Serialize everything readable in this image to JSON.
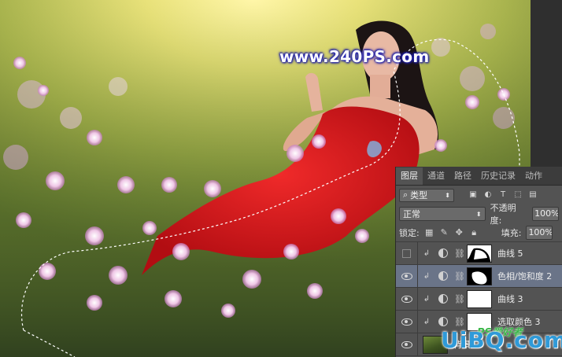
{
  "watermark": "www.240PS.com",
  "panel": {
    "tabs": [
      "图层",
      "通道",
      "路径",
      "历史记录",
      "动作"
    ],
    "active_tab": "图层",
    "filter_label": "类型",
    "blend_mode": "正常",
    "opacity_label": "不透明度:",
    "opacity_value": "100%",
    "lock_label": "锁定:",
    "fill_label": "填充:",
    "fill_value": "100%",
    "layers": [
      {
        "name": "曲线 5",
        "visible": false,
        "mask": "white-shape"
      },
      {
        "name": "色相/饱和度 2",
        "visible": true,
        "mask": "black-shape",
        "selected": true
      },
      {
        "name": "曲线 3",
        "visible": true,
        "mask": "white"
      },
      {
        "name": "选取颜色 3",
        "visible": true,
        "mask": "white"
      },
      {
        "name": "背景",
        "visible": true,
        "mask": "photo"
      }
    ]
  },
  "site_logo": "UiBQ.com",
  "site_sub": "PS爱好者"
}
